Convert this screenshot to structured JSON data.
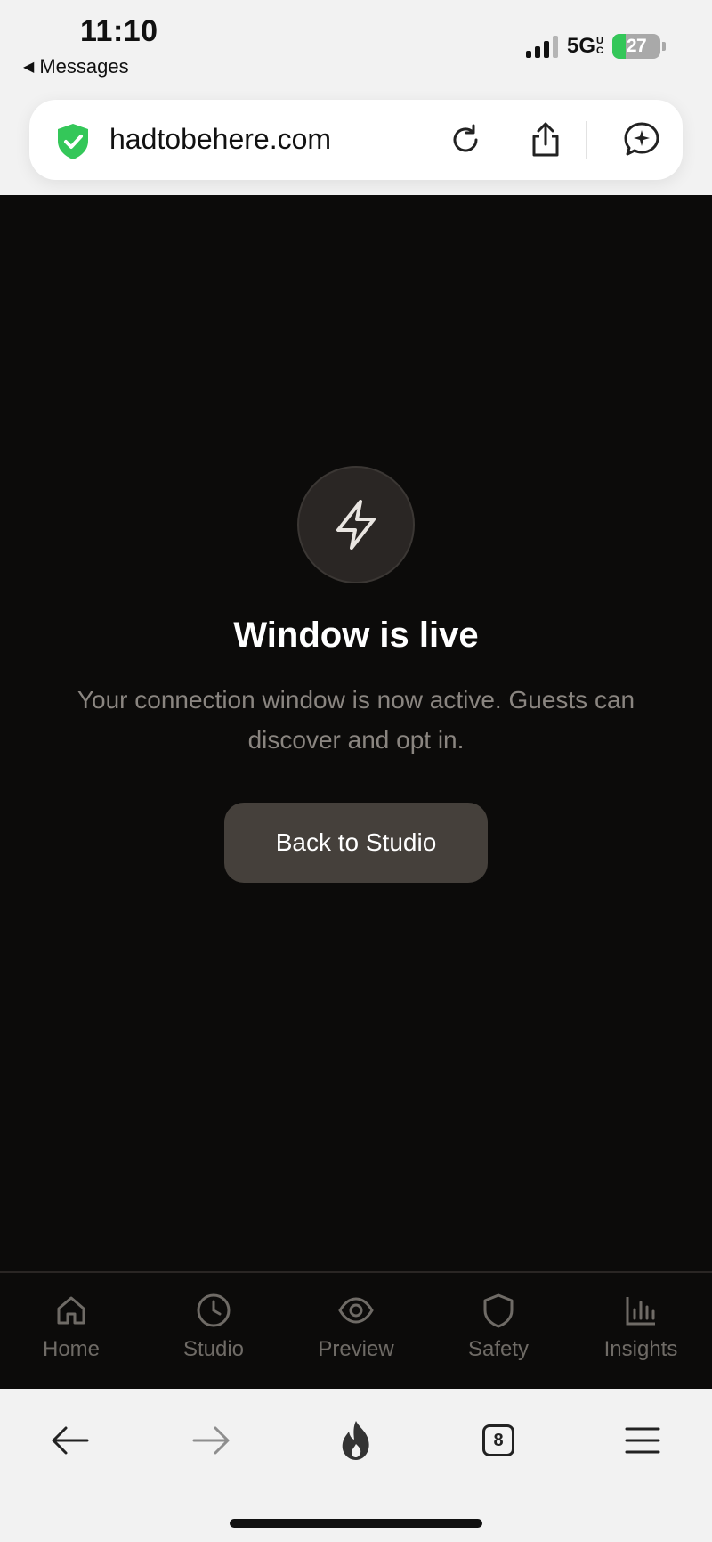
{
  "status_bar": {
    "time": "11:10",
    "back_app": "Messages",
    "network": "5G",
    "network_suffix_top": "U",
    "network_suffix_bottom": "C",
    "battery": "27"
  },
  "browser": {
    "url": "hadtobehere.com",
    "tab_count": "8"
  },
  "main": {
    "title": "Window is live",
    "description": "Your connection window is now active. Guests can discover and opt in.",
    "back_button": "Back to Studio"
  },
  "tabbar": {
    "items": [
      {
        "label": "Home",
        "icon": "home-icon"
      },
      {
        "label": "Studio",
        "icon": "clock-icon"
      },
      {
        "label": "Preview",
        "icon": "eye-icon"
      },
      {
        "label": "Safety",
        "icon": "shield-icon"
      },
      {
        "label": "Insights",
        "icon": "bar-chart-icon"
      }
    ]
  },
  "colors": {
    "app_bg": "#0c0b0a",
    "button_bg": "#45403b",
    "muted_text": "#8a8580",
    "shield_green": "#34c759"
  }
}
